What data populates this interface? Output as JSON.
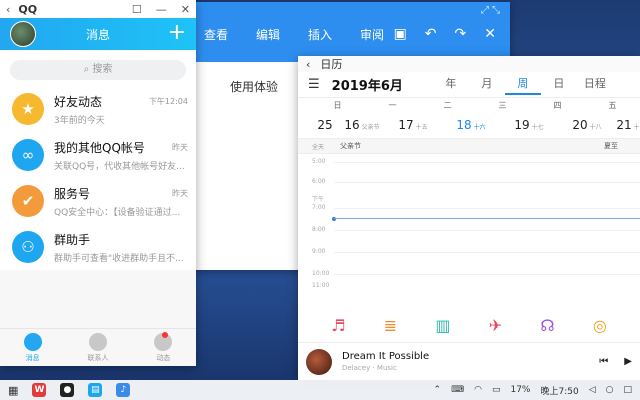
{
  "doc": {
    "tabs": [
      "查看",
      "编辑",
      "插入",
      "审阅"
    ],
    "body_text": "使用体验"
  },
  "qq": {
    "title": "QQ",
    "header_title": "消息",
    "search_placeholder": "搜索",
    "items": [
      {
        "name": "好友动态",
        "sub": "3年前的今天",
        "time": "下午12:04",
        "color": "#f5b82e",
        "icon": "star-icon"
      },
      {
        "name": "我的其他QQ帐号",
        "sub": "关联QQ号，代收其他帐号好友...",
        "time": "昨天",
        "color": "#1ea7f0",
        "icon": "link-icon"
      },
      {
        "name": "服务号",
        "sub": "QQ安全中心：【设备验证通过...",
        "time": "昨天",
        "color": "#f39a3b",
        "icon": "shield-icon"
      },
      {
        "name": "群助手",
        "sub": "群助手可查看\"收进群助手且不...",
        "time": "",
        "color": "#1ea7f0",
        "icon": "group-icon"
      }
    ],
    "tabs": [
      "消息",
      "联系人",
      "动态"
    ]
  },
  "calendar": {
    "title": "日历",
    "month": "2019年6月",
    "views": [
      "年",
      "月",
      "周",
      "日",
      "日程"
    ],
    "active_view": "周",
    "weekdays": [
      "日",
      "一",
      "二",
      "三",
      "四",
      "五"
    ],
    "days": [
      {
        "n": "25",
        "l": ""
      },
      {
        "n": "16",
        "l": "父亲节"
      },
      {
        "n": "17",
        "l": "十五"
      },
      {
        "n": "18",
        "l": "十六"
      },
      {
        "n": "19",
        "l": "十七"
      },
      {
        "n": "20",
        "l": "十八"
      },
      {
        "n": "21",
        "l": "十"
      }
    ],
    "allday_label": "全天",
    "allday_events": [
      "父亲节",
      "夏至"
    ],
    "hours": [
      "5:00",
      "6:00",
      "下午",
      "7:00",
      "8:00",
      "9:00",
      "10:00",
      "11:00"
    ],
    "song_title": "Dream It Possible",
    "song_artist": "Delacey · Music"
  },
  "taskbar": {
    "battery": "17%",
    "time": "晚上7:50"
  }
}
